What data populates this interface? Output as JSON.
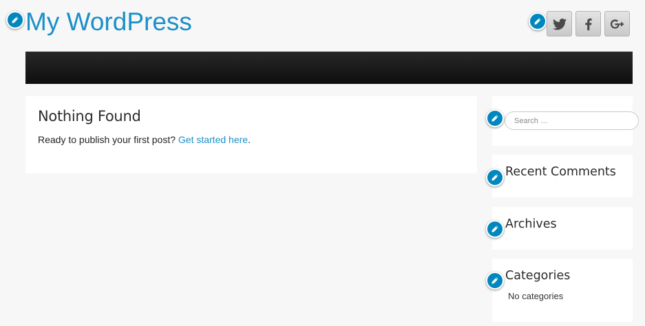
{
  "site": {
    "title": "My WordPress"
  },
  "social": {
    "items": [
      {
        "name": "twitter",
        "icon": "twitter-icon"
      },
      {
        "name": "facebook",
        "icon": "facebook-icon"
      },
      {
        "name": "google-plus",
        "icon": "google-plus-icon"
      }
    ]
  },
  "main": {
    "heading": "Nothing Found",
    "text_before_link": "Ready to publish your first post?",
    "link_text": "Get started here",
    "text_after_link": "."
  },
  "sidebar": {
    "search": {
      "placeholder": "Search …"
    },
    "recent_comments": {
      "title": "Recent Comments"
    },
    "archives": {
      "title": "Archives"
    },
    "categories": {
      "title": "Categories",
      "empty_text": "No categories"
    }
  },
  "colors": {
    "accent": "#1a8fc9",
    "edit_badge": "#0087be",
    "background": "#f7f7f7",
    "nav": "#1a1a1a"
  }
}
